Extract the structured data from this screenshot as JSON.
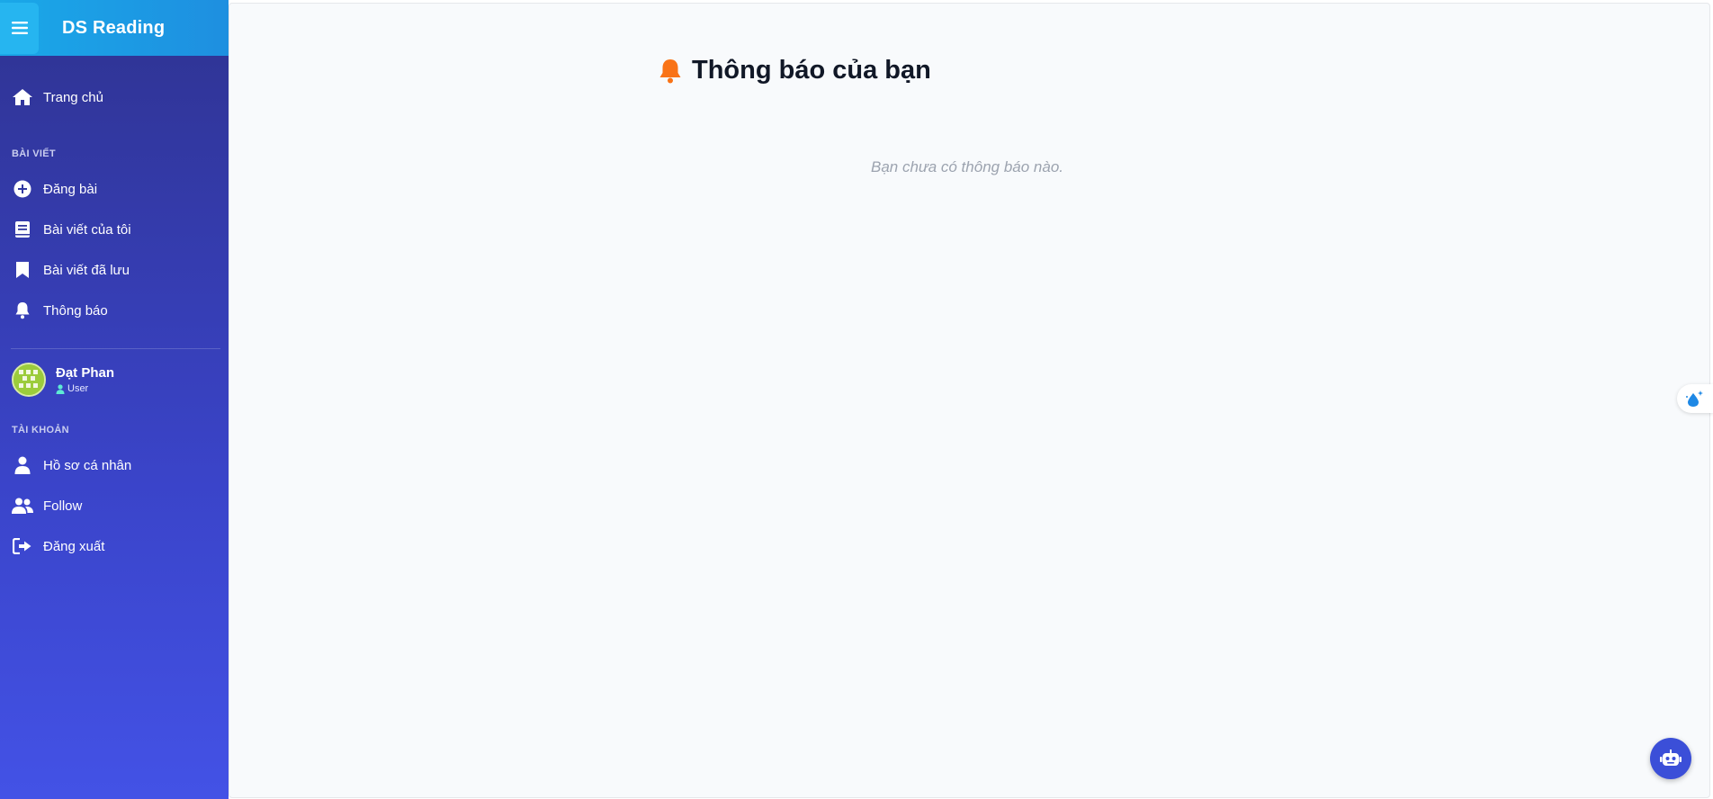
{
  "app": {
    "brand": "DS Reading"
  },
  "sidebar": {
    "home": {
      "label": "Trang chủ",
      "icon": "home-icon"
    },
    "section_posts": "BÀI VIẾT",
    "posts": [
      {
        "label": "Đăng bài",
        "icon": "plus-circle-icon"
      },
      {
        "label": "Bài viết của tôi",
        "icon": "book-icon"
      },
      {
        "label": "Bài viết đã lưu",
        "icon": "bookmark-icon"
      },
      {
        "label": "Thông báo",
        "icon": "bell-icon"
      }
    ],
    "user": {
      "name": "Đạt Phan",
      "role": "User"
    },
    "section_account": "TÀI KHOẢN",
    "account": [
      {
        "label": "Hồ sơ cá nhân",
        "icon": "user-icon"
      },
      {
        "label": "Follow",
        "icon": "users-icon"
      },
      {
        "label": "Đăng xuất",
        "icon": "logout-icon"
      }
    ]
  },
  "main": {
    "title": "Thông báo của bạn",
    "empty_message": "Bạn chưa có thông báo nào."
  },
  "colors": {
    "sidebar_top": "#2f3391",
    "sidebar_bottom": "#4352e6",
    "brand_bar": "#1aa8e8",
    "bell_accent": "#f97316",
    "bot_button": "#3b4fd8"
  }
}
